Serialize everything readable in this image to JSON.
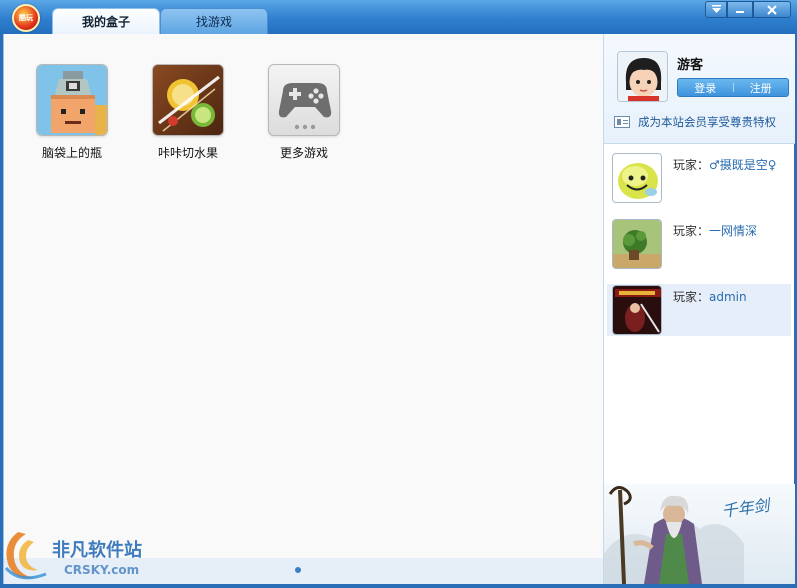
{
  "titlebar": {
    "logo_text": "酷玩",
    "tabs": [
      {
        "label": "我的盒子",
        "active": true
      },
      {
        "label": "找游戏",
        "active": false
      }
    ],
    "buttons": {
      "menu": "▾",
      "minimize": "—",
      "close": "✕"
    }
  },
  "games": [
    {
      "label": "脑袋上的瓶",
      "icon": "bottle-head-game-icon"
    },
    {
      "label": "咔咔切水果",
      "icon": "fruit-slice-game-icon"
    },
    {
      "label": "更多游戏",
      "icon": "gamepad-icon"
    }
  ],
  "user": {
    "name": "游客",
    "login_label": "登录",
    "separator": "|",
    "register_label": "注册",
    "member_promo": "成为本站会员享受尊贵特权"
  },
  "players": [
    {
      "prefix": "玩家：",
      "name": "♂摄既是空♀",
      "thumb": "smiley-avatar"
    },
    {
      "prefix": "玩家：",
      "name": "一网情深",
      "thumb": "green-creature-avatar"
    },
    {
      "prefix": "玩家：",
      "name": "admin",
      "thumb": "warrior-game-avatar"
    }
  ],
  "banner": {
    "calligraphy": "千年剑"
  },
  "watermark": {
    "cn": "非凡软件站",
    "en": "CRSKY.com"
  },
  "colors": {
    "titlebar": "#2f7fcf",
    "accent": "#3e93dc",
    "link": "#2a6cb0"
  }
}
